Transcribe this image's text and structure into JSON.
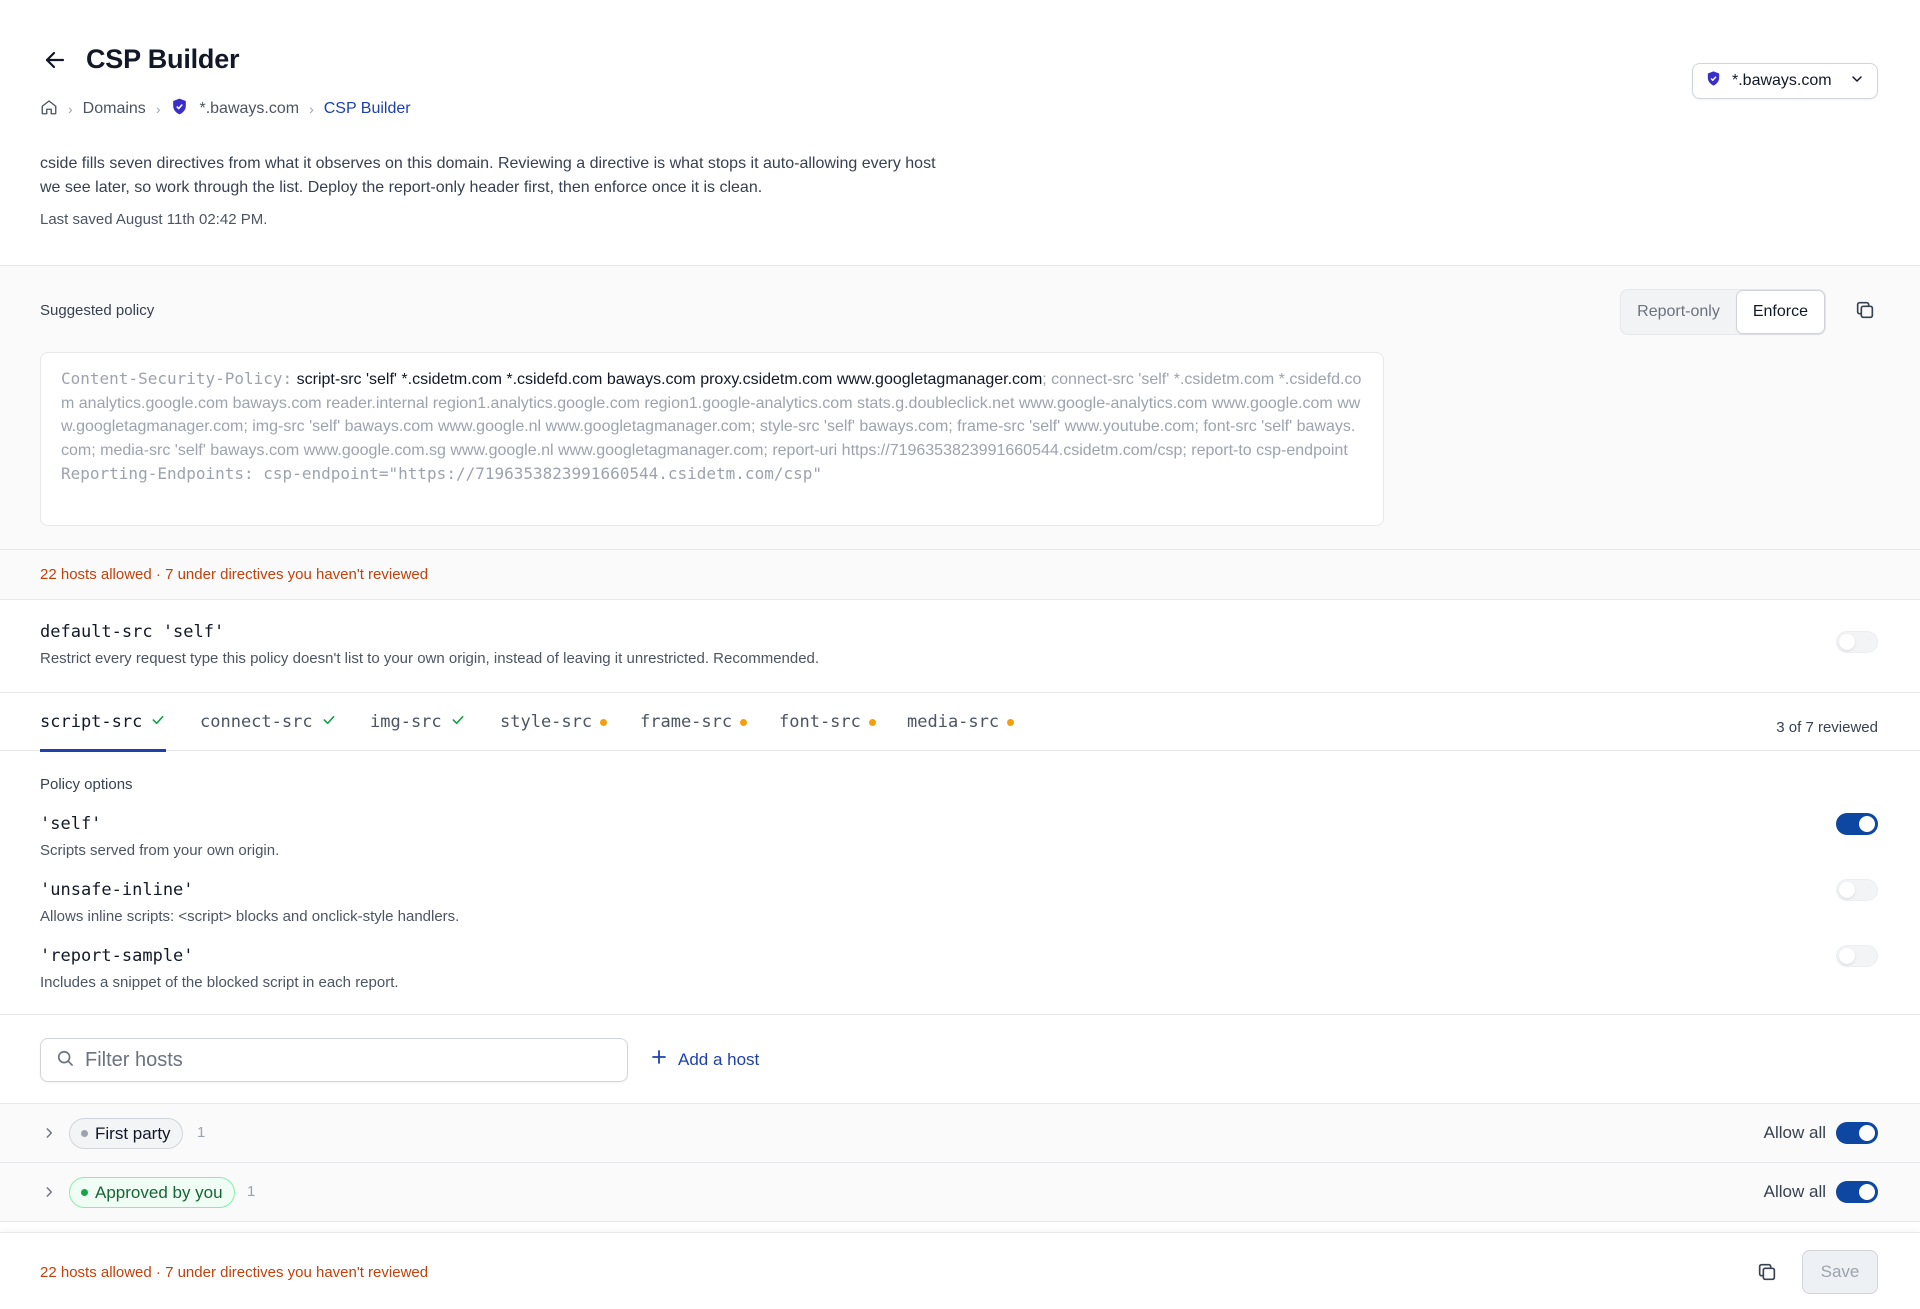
{
  "header": {
    "title": "CSP Builder",
    "breadcrumb": [
      "Domains",
      "*.baways.com",
      "CSP Builder"
    ],
    "domain_selector": "*.baways.com",
    "description_line1": "cside fills seven directives from what it observes on this domain. Reviewing a directive is what stops it auto-allowing every host",
    "description_line2": "we see later, so work through the list. Deploy the report-only header first, then enforce once it is clean.",
    "last_saved": "Last saved August 11th 02:42 PM."
  },
  "policy": {
    "label": "Suggested policy",
    "modes": [
      "Report-only",
      "Enforce"
    ],
    "active_mode": "Enforce",
    "header_name": "Content-Security-Policy:",
    "script_src": "script-src 'self' *.csidetm.com *.csidefd.com baways.com proxy.csidetm.com www.googletagmanager.com",
    "rest": "connect-src 'self' *.csidetm.com *.csidefd.com analytics.google.com baways.com reader.internal region1.analytics.google.com region1.google-analytics.com stats.g.doubleclick.net www.google-analytics.com www.google.com www.googletagmanager.com; img-src 'self' baways.com www.google.nl www.googletagmanager.com; style-src 'self' baways.com; frame-src 'self' www.youtube.com; font-src 'self' baways.com; media-src 'self' baways.com www.google.com.sg www.google.nl www.googletagmanager.com; report-uri https://7196353823991660544.csidetm.com/csp; report-to csp-endpoint",
    "reporting_line": "Reporting-Endpoints: csp-endpoint=\"https://7196353823991660544.csidetm.com/csp\""
  },
  "summary": "22 hosts allowed · 7 under directives you haven't reviewed",
  "default_src": {
    "directive": "default-src 'self'",
    "description": "Restrict every request type this policy doesn't list to your own origin, instead of leaving it unrestricted. Recommended.",
    "enabled": false
  },
  "tabs": [
    {
      "label": "script-src",
      "status": "reviewed"
    },
    {
      "label": "connect-src",
      "status": "reviewed"
    },
    {
      "label": "img-src",
      "status": "reviewed"
    },
    {
      "label": "style-src",
      "status": "pending"
    },
    {
      "label": "frame-src",
      "status": "pending"
    },
    {
      "label": "font-src",
      "status": "pending"
    },
    {
      "label": "media-src",
      "status": "pending"
    }
  ],
  "reviewed_count": "3 of 7 reviewed",
  "options": {
    "title": "Policy options",
    "items": [
      {
        "name": "'self'",
        "description": "Scripts served from your own origin.",
        "enabled": true
      },
      {
        "name": "'unsafe-inline'",
        "description": "Allows inline scripts: <script> blocks and onclick-style handlers.",
        "enabled": false
      },
      {
        "name": "'report-sample'",
        "description": "Includes a snippet of the blocked script in each report.",
        "enabled": false
      }
    ]
  },
  "filter": {
    "placeholder": "Filter hosts",
    "add_host_label": "Add a host"
  },
  "groups": [
    {
      "label": "First party",
      "count": "1",
      "allow_label": "Allow all",
      "enabled": true,
      "color": "#9ca3af"
    },
    {
      "label": "Approved by you",
      "count": "1",
      "allow_label": "Allow all",
      "enabled": true,
      "color": "#16a34a"
    }
  ],
  "footer": {
    "summary": "22 hosts allowed · 7 under directives you haven't reviewed",
    "save_label": "Save"
  },
  "colors": {
    "accent": "#0d47a1",
    "warning": "#c2410c",
    "pending_dot": "#f59e0b",
    "approved": "#16a34a"
  }
}
